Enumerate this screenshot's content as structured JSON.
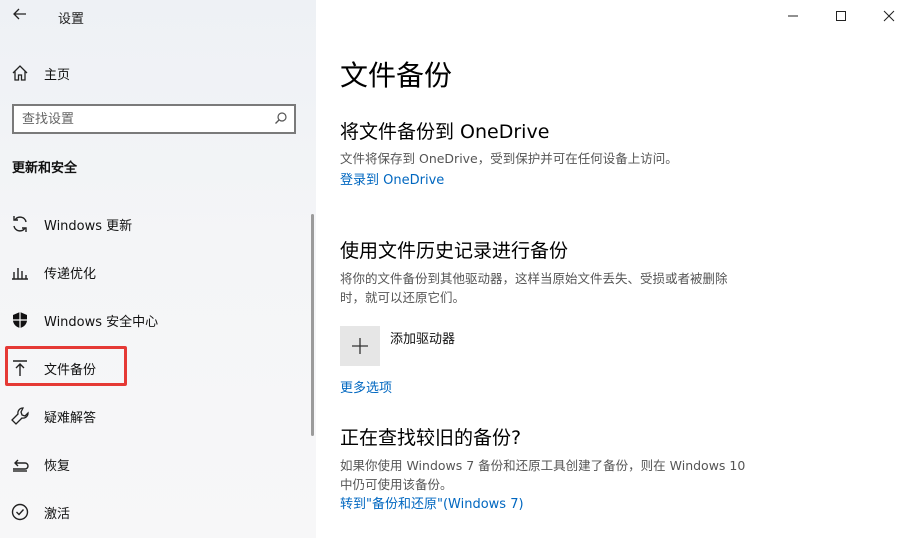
{
  "window": {
    "title": "设置"
  },
  "sidebar": {
    "home_label": "主页",
    "search_placeholder": "查找设置",
    "section_title": "更新和安全",
    "items": [
      {
        "label": "Windows 更新",
        "icon": "sync-icon"
      },
      {
        "label": "传递优化",
        "icon": "delivery-optimization-icon"
      },
      {
        "label": "Windows 安全中心",
        "icon": "shield-icon"
      },
      {
        "label": "文件备份",
        "icon": "backup-icon",
        "selected": true
      },
      {
        "label": "疑难解答",
        "icon": "wrench-icon"
      },
      {
        "label": "恢复",
        "icon": "recovery-icon"
      },
      {
        "label": "激活",
        "icon": "activation-icon"
      }
    ]
  },
  "main": {
    "page_title": "文件备份",
    "onedrive": {
      "heading": "将文件备份到 OneDrive",
      "desc": "文件将保存到 OneDrive，受到保护并可在任何设备上访问。",
      "link": "登录到 OneDrive"
    },
    "history": {
      "heading": "使用文件历史记录进行备份",
      "desc_line1": "将你的文件备份到其他驱动器，这样当原始文件丢失、受损或者被删除",
      "desc_line2": "时，就可以还原它们。",
      "add_drive_label": "添加驱动器",
      "more_options": "更多选项"
    },
    "older": {
      "heading": "正在查找较旧的备份?",
      "desc_line1": "如果你使用 Windows 7 备份和还原工具创建了备份，则在 Windows 10",
      "desc_line2": "中仍可使用该备份。",
      "link": "转到\"备份和还原\"(Windows 7)"
    }
  },
  "colors": {
    "accent": "#0067c0",
    "highlight": "#e53935"
  }
}
